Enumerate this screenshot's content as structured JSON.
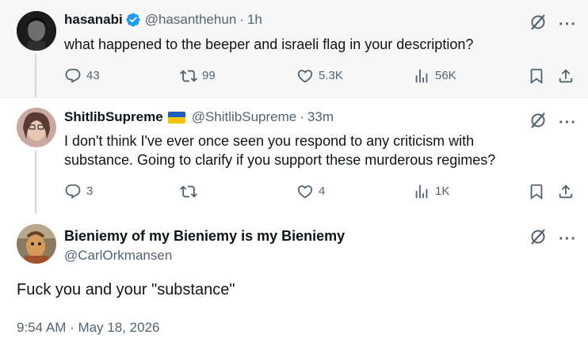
{
  "colors": {
    "text": "#0f1419",
    "secondary": "#536471",
    "verified": "#1d9bf0",
    "thread_line": "#cfd9de",
    "highlight_bg": "#f7f7f7"
  },
  "tweets": [
    {
      "name": "hasanabi",
      "handle": "@hasanthehun",
      "time": "1h",
      "verified": true,
      "text": "what happened to the beeper and israeli flag in your description?",
      "replies": "43",
      "reposts": "99",
      "likes": "5.3K",
      "views": "56K"
    },
    {
      "name": "ShitlibSupreme",
      "handle": "@ShitlibSupreme",
      "time": "33m",
      "flag": "ukraine-flag",
      "text_line1": "I don't think I've ever once seen you respond to any criticism with",
      "text_line2": "substance. Going to clarify if you support these murderous regimes?",
      "replies": "3",
      "reposts": "",
      "likes": "4",
      "views": "1K"
    }
  ],
  "main_tweet": {
    "name": "Bieniemy of my Bieniemy is my Bieniemy",
    "handle": "@CarlOrkmansen",
    "text": "Fuck you and your \"substance\"",
    "timestamp": "9:54 AM · May 18, 2026"
  },
  "icons": {
    "reply": "reply-icon",
    "repost": "repost-icon",
    "like": "heart-icon",
    "views": "views-icon",
    "bookmark": "bookmark-icon",
    "share": "share-icon",
    "grok": "grok-icon",
    "more": "more-icon"
  }
}
